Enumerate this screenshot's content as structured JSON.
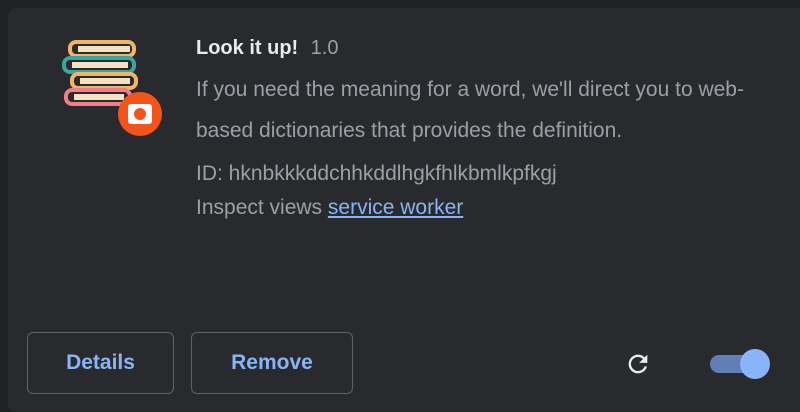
{
  "extension": {
    "name": "Look it up!",
    "version": "1.0",
    "description": "If you need the meaning for a word, we'll direct you to web-based dictionaries that provides the definition.",
    "id_line": "ID: hknbkkkddchhkddlhgkfhlkbmlkpfkgj",
    "inspect_label": "Inspect views",
    "inspect_link": "service worker",
    "icon": "books-stack-icon",
    "enabled": true
  },
  "footer": {
    "details_label": "Details",
    "remove_label": "Remove",
    "reload_icon": "reload-icon",
    "toggle_state": "on"
  },
  "colors": {
    "background": "#202124",
    "card": "#292a2d",
    "primary_text": "#e8eaed",
    "secondary_text": "#9aa0a6",
    "accent": "#8ab4f8",
    "icon_badge": "#f2541b"
  }
}
